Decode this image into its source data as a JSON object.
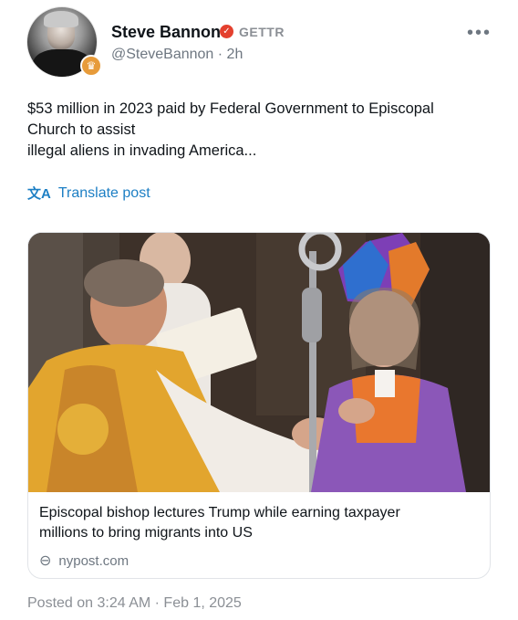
{
  "author": {
    "name": "Steve Bannon",
    "platform": "GETTR",
    "handle": "@SteveBannon",
    "separator": "·",
    "time_ago": "2h",
    "handle_line": "@SteveBannon · 2h"
  },
  "post": {
    "lines": [
      "$53 million in 2023 paid by Federal Government to Episcopal",
      "Church to assist",
      "illegal aliens in invading America..."
    ],
    "translate_label": "Translate post"
  },
  "link_card": {
    "title_lines": [
      "Episcopal bishop lectures Trump while earning taxpayer",
      "millions to bring migrants into US"
    ],
    "source": "nypost.com"
  },
  "footer": {
    "posted": "Posted on 3:24 AM · Feb 1, 2025"
  },
  "icons": {
    "more": "more-options-icon",
    "verified": "verified-icon",
    "translate": "translate-icon",
    "link": "link-icon"
  },
  "colors": {
    "link_blue": "#1d7fc4",
    "verified_red": "#e4402e",
    "muted_gray": "#6e7781"
  }
}
